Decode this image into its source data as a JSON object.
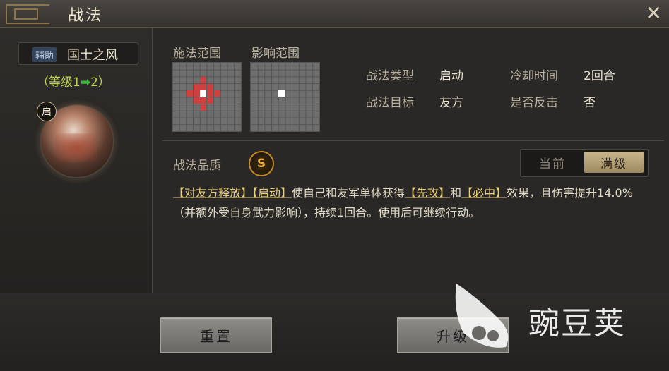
{
  "window": {
    "title": "战法",
    "close_icon": "close-icon"
  },
  "skill": {
    "badge": "辅助",
    "name": "国士之风",
    "level_prefix": "（等级1",
    "level_arrow": "➡",
    "level_suffix": "2）",
    "portrait_badge": "启"
  },
  "ranges": {
    "cast_label": "施法范围",
    "effect_label": "影响范围"
  },
  "info": {
    "type_label": "战法类型",
    "type_value": "启动",
    "cooldown_label": "冷却时间",
    "cooldown_value": "2回合",
    "target_label": "战法目标",
    "target_value": "友方",
    "counter_label": "是否反击",
    "counter_value": "否"
  },
  "quality": {
    "label": "战法品质",
    "grade": "S"
  },
  "toggle": {
    "current": "当前",
    "max": "满级",
    "selected": "max"
  },
  "description": {
    "p1": "【对友方释放】",
    "p2": "【启动】",
    "p3": "使自己和友军单体获得",
    "p4": "【先攻】",
    "p5": "和",
    "p6": "【必中】",
    "p7": "效果，且伤害提升14.0%（并额外受自身武力影响），持续1回合。使用后可继续行动。"
  },
  "buttons": {
    "reset": "重置",
    "upgrade": "升级"
  },
  "watermark": {
    "text": "豌豆荚"
  },
  "colors": {
    "accent_gold": "#c8b68c",
    "level_green": "#c2d64e",
    "range_red": "#d04040"
  }
}
